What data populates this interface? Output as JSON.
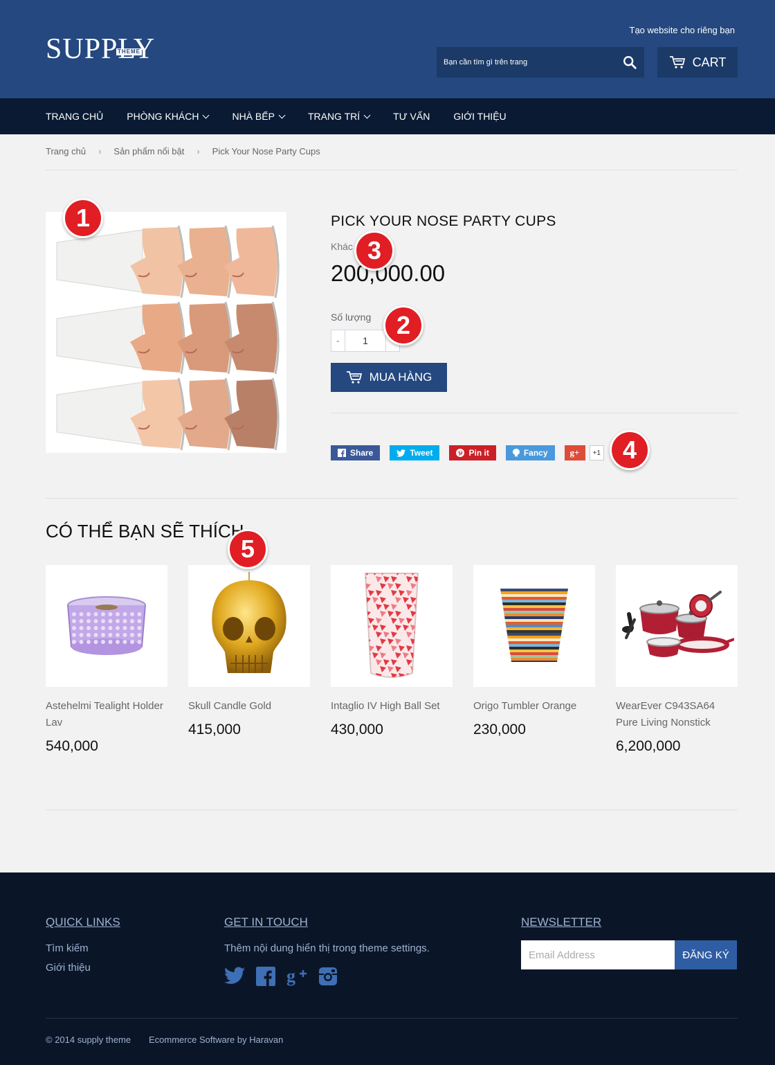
{
  "header": {
    "logo": "SUPPLY",
    "logo_sub": "THEME",
    "tagline": "Tạo website cho riêng bạn",
    "search_placeholder": "Bạn cần tìm gì trên trang",
    "cart_label": "CART"
  },
  "nav": {
    "items": [
      {
        "label": "TRANG CHỦ",
        "dropdown": false
      },
      {
        "label": "PHÒNG KHÁCH",
        "dropdown": true
      },
      {
        "label": "NHÀ BẾP",
        "dropdown": true
      },
      {
        "label": "TRANG TRÍ",
        "dropdown": true
      },
      {
        "label": "TƯ VẤN",
        "dropdown": false
      },
      {
        "label": "GIỚI THIỆU",
        "dropdown": false
      }
    ]
  },
  "breadcrumb": [
    "Trang chủ",
    "Sản phẩm nổi bật",
    "Pick Your Nose Party Cups"
  ],
  "product": {
    "title": "PICK YOUR NOSE PARTY CUPS",
    "vendor": "Khác",
    "price": "200,000.00",
    "qty_label": "Số lượng",
    "qty_minus": "-",
    "qty": "1",
    "buy_label": "MUA HÀNG"
  },
  "share": {
    "facebook": "Share",
    "twitter": "Tweet",
    "pinterest": "Pin it",
    "fancy": "Fancy",
    "gplus": "g+",
    "gplus_count": "+1",
    "colors": {
      "facebook": "#3b5998",
      "twitter": "#00aced",
      "pinterest": "#cb2027",
      "fancy": "#4999dc",
      "gplus": "#dd4b39"
    }
  },
  "badges": [
    "1",
    "2",
    "3",
    "4",
    "5"
  ],
  "related": {
    "title": "CÓ THỂ BẠN SẼ THÍCH",
    "items": [
      {
        "name": "Astehelmi Tealight Holder Lav",
        "price": "540,000"
      },
      {
        "name": "Skull Candle Gold",
        "price": "415,000"
      },
      {
        "name": "Intaglio IV High Ball Set",
        "price": "430,000"
      },
      {
        "name": "Origo Tumbler Orange",
        "price": "230,000"
      },
      {
        "name": "WearEver C943SA64 Pure Living Nonstick",
        "price": "6,200,000"
      }
    ]
  },
  "footer": {
    "quick_links_title": "QUICK LINKS",
    "quick_links": [
      "Tìm kiếm",
      "Giới thiệu"
    ],
    "contact_title": "GET IN TOUCH",
    "contact_text": "Thêm nội dung hiển thị trong theme settings.",
    "newsletter_title": "NEWSLETTER",
    "email_placeholder": "Email Address",
    "subscribe_label": "ĐĂNG KÝ",
    "copyright": "© 2014 supply theme",
    "powered": "Ecommerce Software by Haravan"
  },
  "theme_colors": {
    "header": "#24487f",
    "nav": "#0a1a33",
    "footer": "#0a1628",
    "badge": "#e01e24"
  }
}
